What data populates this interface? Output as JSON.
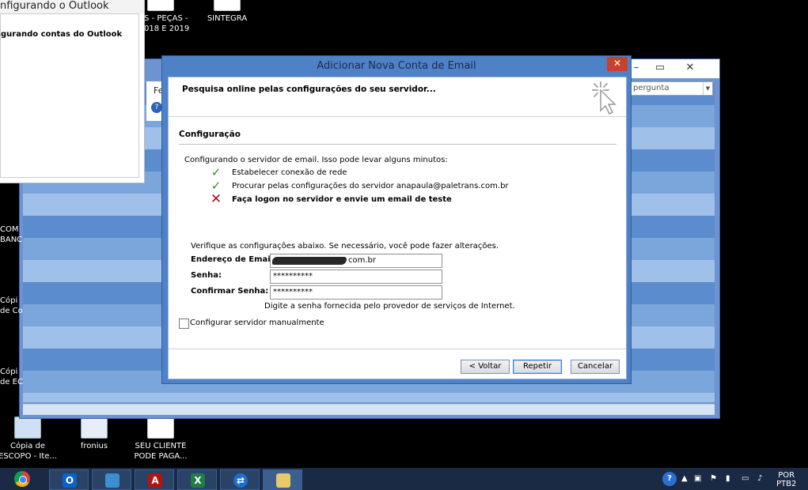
{
  "desktop": {
    "icons": [
      {
        "label": "S - PEÇAS -\n018 E 2019",
        "icon": "folder-icon"
      },
      {
        "label": "SINTEGRA",
        "icon": "pdf-file-icon"
      },
      {
        "label": "Cópia de\nESCOPO - Ite...",
        "icon": "document-icon"
      },
      {
        "label": "fronius",
        "icon": "document-icon"
      },
      {
        "label": "SEU CLIENTE\nPODE PAGA...",
        "icon": "pdf-file-icon"
      }
    ],
    "left_fragments": [
      "COM\nBANC",
      "Cópi\nde Co",
      "Cópi\nde EC"
    ]
  },
  "setup_window": {
    "title": "nfigurando o Outlook",
    "heading": "gurando contas do Outlook"
  },
  "outlook_window": {
    "tab_fragment": "Fe",
    "search_placeholder": "pergunta",
    "minimize": "–",
    "maximize": "▭",
    "close": "✕"
  },
  "dialog": {
    "title": "Adicionar Nova Conta de Email",
    "close": "✕",
    "header_text": "Pesquisa online pelas configurações do seu servidor...",
    "section_title": "Configuração",
    "status_intro": "Configurando o servidor de email. Isso pode levar alguns minutos:",
    "steps": [
      {
        "label": "Estabelecer conexão de rede",
        "status": "ok",
        "mark": "✓"
      },
      {
        "label": "Procurar pelas configurações do servidor anapaula@paletrans.com.br",
        "status": "ok",
        "mark": "✓"
      },
      {
        "label": "Faça logon no servidor e envie um email de teste",
        "status": "error",
        "mark": "✕"
      }
    ],
    "verify_text": "Verifique as configurações abaixo. Se necessário, você pode fazer alterações.",
    "fields": {
      "email_label": "Endereço de Email:",
      "email_value_visible": "com.br",
      "password_label": "Senha:",
      "password_value": "**********",
      "confirm_label": "Confirmar Senha:",
      "confirm_value": "**********"
    },
    "hint": "Digite a senha fornecida pelo provedor de serviços de Internet.",
    "manual_checkbox_label": "Configurar servidor manualmente",
    "manual_checked": false,
    "buttons": {
      "back": "< Voltar",
      "retry": "Repetir",
      "cancel": "Cancelar"
    }
  },
  "taskbar": {
    "apps": [
      "chrome-icon",
      "outlook-icon",
      "remote-desktop-icon",
      "acrobat-icon",
      "excel-icon",
      "teamviewer-icon",
      "outlook-setup-icon"
    ],
    "tray_language": "POR\nPTB2"
  },
  "colors": {
    "dialog_frame": "#4f81c7",
    "close_red": "#c7412f",
    "check_green": "#2e8b2e",
    "error_red": "#a11111",
    "taskbar": "#1a2a44"
  }
}
